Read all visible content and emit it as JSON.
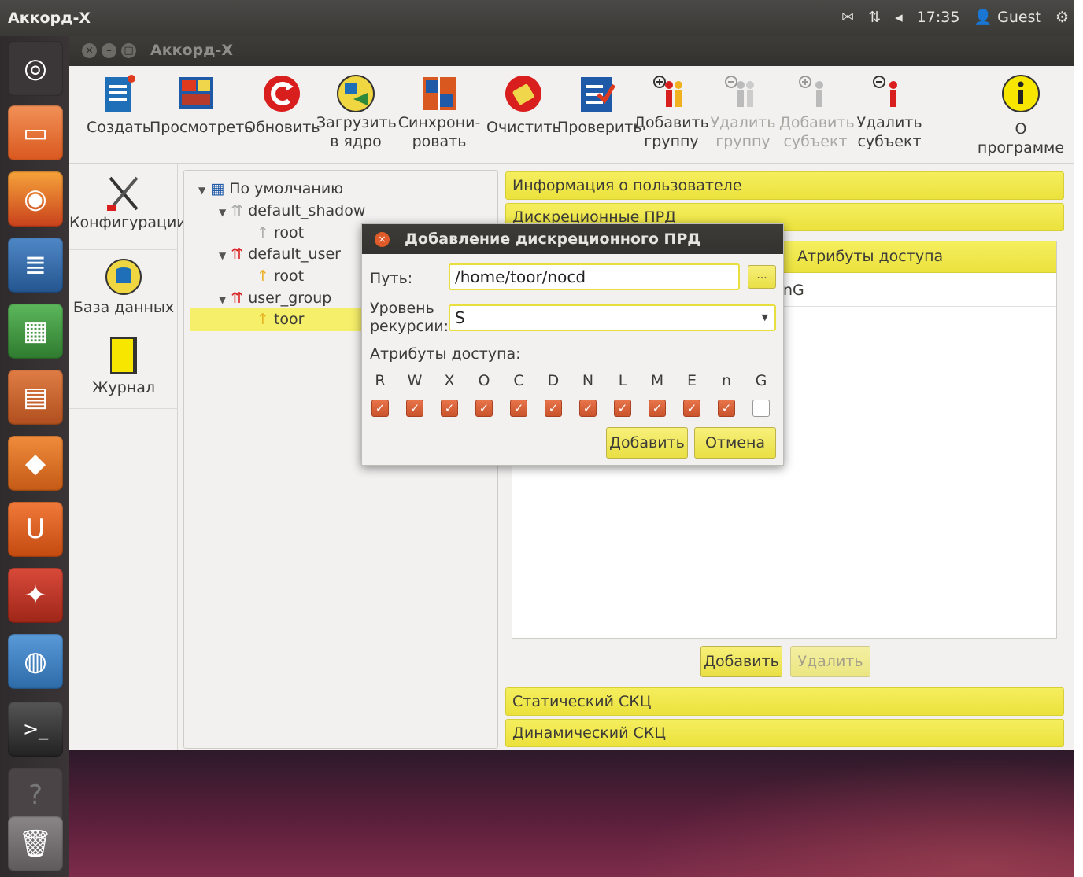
{
  "topbar": {
    "app_title": "Аккорд-Х",
    "time": "17:35",
    "user": "Guest"
  },
  "window": {
    "title": "Аккорд-Х"
  },
  "toolbar": [
    {
      "label": "Создать",
      "icon": "create-icon"
    },
    {
      "label": "Просмотреть",
      "icon": "view-icon"
    },
    {
      "label": "Обновить",
      "icon": "refresh-icon"
    },
    {
      "label": "Загрузить\nв ядро",
      "icon": "load-kernel-icon"
    },
    {
      "label": "Синхрони-\nровать",
      "icon": "sync-icon"
    },
    {
      "label": "Очистить",
      "icon": "clear-icon"
    },
    {
      "label": "Проверить",
      "icon": "check-icon"
    },
    {
      "label": "Добавить\nгруппу",
      "icon": "add-group-icon"
    },
    {
      "label": "Удалить\nгруппу",
      "icon": "remove-group-icon"
    },
    {
      "label": "Добавить\nсубъект",
      "icon": "add-subject-icon"
    },
    {
      "label": "Удалить\nсубъект",
      "icon": "remove-subject-icon"
    },
    {
      "label": "О программе",
      "icon": "info-icon"
    }
  ],
  "nav": [
    {
      "label": "Конфигурации"
    },
    {
      "label": "База данных"
    },
    {
      "label": "Журнал"
    }
  ],
  "tree": [
    {
      "label": "По умолчанию"
    },
    {
      "label": "default_shadow"
    },
    {
      "label": "root"
    },
    {
      "label": "default_user"
    },
    {
      "label": "root"
    },
    {
      "label": "user_group"
    },
    {
      "label": "toor"
    }
  ],
  "right": {
    "section_user_info": "Информация о пользователе",
    "section_discretionary": "Дискреционные ПРД",
    "column_access_attrs": "Атрибуты доступа",
    "list_row_attrs_partial": "nG",
    "add_button": "Добавить",
    "remove_button": "Удалить",
    "section_static": "Статический СКЦ",
    "section_dynamic": "Динамический СКЦ"
  },
  "dialog": {
    "title": "Добавление дискреционного ПРД",
    "path_label": "Путь:",
    "path_value": "/home/toor/nocd",
    "browse_button": "...",
    "recursion_label": "Уровень\nрекурсии:",
    "recursion_value": "S",
    "attrs_label": "Атрибуты доступа:",
    "attributes": [
      {
        "letter": "R",
        "checked": true
      },
      {
        "letter": "W",
        "checked": true
      },
      {
        "letter": "X",
        "checked": true
      },
      {
        "letter": "O",
        "checked": true
      },
      {
        "letter": "C",
        "checked": true
      },
      {
        "letter": "D",
        "checked": true
      },
      {
        "letter": "N",
        "checked": true
      },
      {
        "letter": "L",
        "checked": true
      },
      {
        "letter": "M",
        "checked": true
      },
      {
        "letter": "E",
        "checked": true
      },
      {
        "letter": "n",
        "checked": true
      },
      {
        "letter": "G",
        "checked": false
      }
    ],
    "add_button": "Добавить",
    "cancel_button": "Отмена"
  },
  "colors": {
    "accent_yellow": "#ebe23d",
    "titlebar": "#3a3936",
    "check_orange": "#d9613a"
  }
}
